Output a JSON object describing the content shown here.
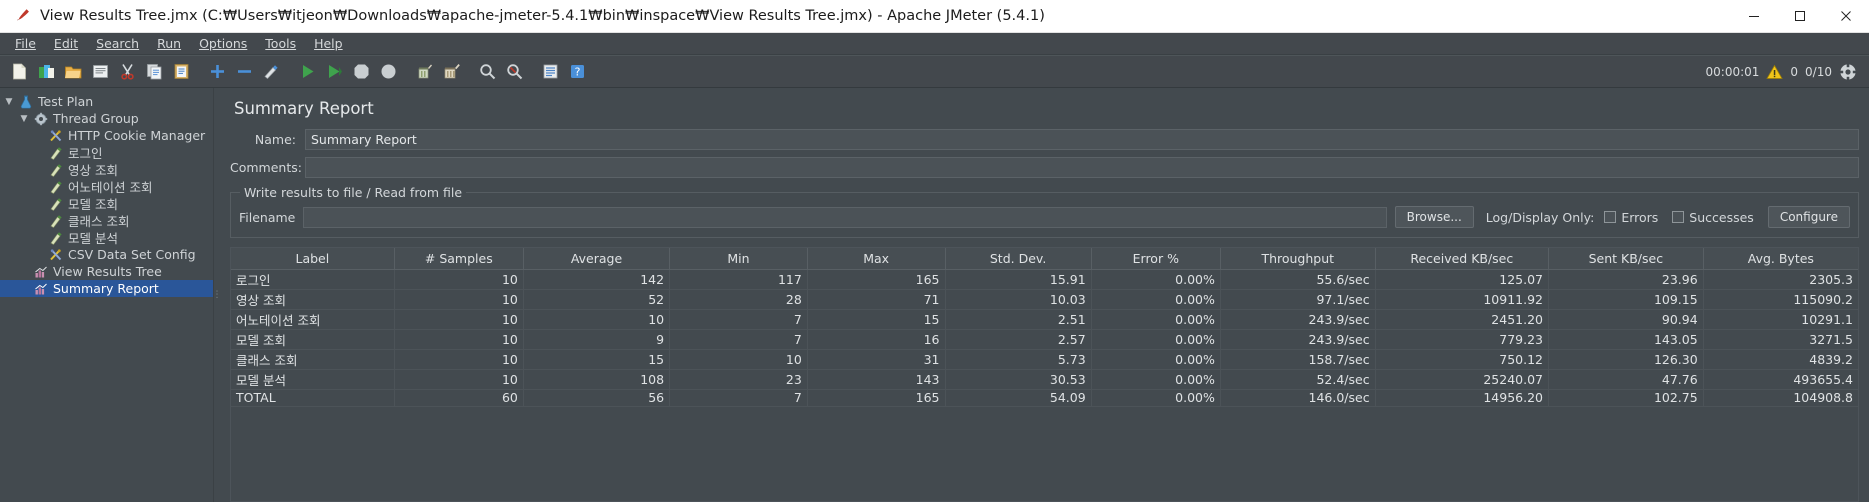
{
  "window": {
    "title": "View Results Tree.jmx (C:₩Users₩itjeon₩Downloads₩apache-jmeter-5.4.1₩bin₩inspace₩View Results Tree.jmx) - Apache JMeter (5.4.1)",
    "app_icon": "jmeter-feather-icon",
    "minimize": "—",
    "maximize": "▢",
    "close": "✕"
  },
  "menubar": {
    "items": [
      {
        "label": "File"
      },
      {
        "label": "Edit"
      },
      {
        "label": "Search"
      },
      {
        "label": "Run"
      },
      {
        "label": "Options"
      },
      {
        "label": "Tools"
      },
      {
        "label": "Help"
      }
    ]
  },
  "toolbar": {
    "buttons": [
      {
        "name": "new-test-plan-icon",
        "tip": "New"
      },
      {
        "name": "templates-icon",
        "tip": "Templates"
      },
      {
        "name": "open-icon",
        "tip": "Open"
      },
      {
        "name": "save-icon",
        "tip": "Save Test Plan"
      },
      {
        "name": "cut-icon",
        "tip": "Cut"
      },
      {
        "name": "copy-icon",
        "tip": "Copy"
      },
      {
        "name": "paste-icon",
        "tip": "Paste"
      },
      {
        "name": "expand-all-icon",
        "tip": "Expand All"
      },
      {
        "name": "collapse-all-icon",
        "tip": "Collapse All"
      },
      {
        "name": "toggle-icon",
        "tip": "Toggle"
      },
      {
        "name": "start-icon",
        "tip": "Start"
      },
      {
        "name": "start-no-timers-icon",
        "tip": "Start no pauses"
      },
      {
        "name": "stop-icon",
        "tip": "Stop"
      },
      {
        "name": "shutdown-icon",
        "tip": "Shutdown"
      },
      {
        "name": "clear-icon",
        "tip": "Clear"
      },
      {
        "name": "clear-all-icon",
        "tip": "Clear All"
      },
      {
        "name": "search-icon",
        "tip": "Search"
      },
      {
        "name": "search-reset-icon",
        "tip": "Reset Search"
      },
      {
        "name": "function-helper-icon",
        "tip": "Function Helper Dialog"
      },
      {
        "name": "help-icon",
        "tip": "Help"
      }
    ],
    "status": {
      "elapsed_time": "00:00:01",
      "warning_icon": "warning-triangle-icon",
      "error_count": "0",
      "thread_counts": "0/10",
      "remote_icon": "remote-engines-icon"
    }
  },
  "tree": {
    "nodes": [
      {
        "label": "Test Plan",
        "indent": 0,
        "icon": "test-plan-icon",
        "expander": "expanded",
        "selected": false
      },
      {
        "label": "Thread Group",
        "indent": 1,
        "icon": "thread-group-icon",
        "expander": "expanded",
        "selected": false
      },
      {
        "label": "HTTP Cookie Manager",
        "indent": 2,
        "icon": "config-element-icon",
        "expander": "none",
        "selected": false
      },
      {
        "label": "로그인",
        "indent": 2,
        "icon": "http-sampler-icon",
        "expander": "none",
        "selected": false
      },
      {
        "label": "영상 조회",
        "indent": 2,
        "icon": "http-sampler-icon",
        "expander": "none",
        "selected": false
      },
      {
        "label": "어노테이션 조회",
        "indent": 2,
        "icon": "http-sampler-icon",
        "expander": "none",
        "selected": false
      },
      {
        "label": "모델 조회",
        "indent": 2,
        "icon": "http-sampler-icon",
        "expander": "none",
        "selected": false
      },
      {
        "label": "클래스 조회",
        "indent": 2,
        "icon": "http-sampler-icon",
        "expander": "none",
        "selected": false
      },
      {
        "label": "모델 분석",
        "indent": 2,
        "icon": "http-sampler-icon",
        "expander": "none",
        "selected": false
      },
      {
        "label": "CSV Data Set Config",
        "indent": 2,
        "icon": "config-element-icon",
        "expander": "none",
        "selected": false
      },
      {
        "label": "View Results Tree",
        "indent": 1,
        "icon": "listener-icon",
        "expander": "none",
        "selected": false
      },
      {
        "label": "Summary Report",
        "indent": 1,
        "icon": "listener-icon",
        "expander": "none",
        "selected": true
      }
    ]
  },
  "panel": {
    "title": "Summary Report",
    "name_label": "Name:",
    "name_value": "Summary Report",
    "comments_label": "Comments:",
    "comments_value": "",
    "group_legend": "Write results to file / Read from file",
    "filename_label": "Filename",
    "filename_value": "",
    "browse_button": "Browse...",
    "log_display_label": "Log/Display Only:",
    "errors_label": "Errors",
    "errors_checked": false,
    "successes_label": "Successes",
    "successes_checked": false,
    "configure_button": "Configure"
  },
  "table": {
    "columns": [
      "Label",
      "# Samples",
      "Average",
      "Min",
      "Max",
      "Std. Dev.",
      "Error %",
      "Throughput",
      "Received KB/sec",
      "Sent KB/sec",
      "Avg. Bytes"
    ],
    "rows": [
      {
        "label": "로그인",
        "samples": "10",
        "average": "142",
        "min": "117",
        "max": "165",
        "stddev": "15.91",
        "error": "0.00%",
        "throughput": "55.6/sec",
        "received": "125.07",
        "sent": "23.96",
        "avgbytes": "2305.3"
      },
      {
        "label": "영상 조회",
        "samples": "10",
        "average": "52",
        "min": "28",
        "max": "71",
        "stddev": "10.03",
        "error": "0.00%",
        "throughput": "97.1/sec",
        "received": "10911.92",
        "sent": "109.15",
        "avgbytes": "115090.2"
      },
      {
        "label": "어노테이션 조회",
        "samples": "10",
        "average": "10",
        "min": "7",
        "max": "15",
        "stddev": "2.51",
        "error": "0.00%",
        "throughput": "243.9/sec",
        "received": "2451.20",
        "sent": "90.94",
        "avgbytes": "10291.1"
      },
      {
        "label": "모델 조회",
        "samples": "10",
        "average": "9",
        "min": "7",
        "max": "16",
        "stddev": "2.57",
        "error": "0.00%",
        "throughput": "243.9/sec",
        "received": "779.23",
        "sent": "143.05",
        "avgbytes": "3271.5"
      },
      {
        "label": "클래스 조회",
        "samples": "10",
        "average": "15",
        "min": "10",
        "max": "31",
        "stddev": "5.73",
        "error": "0.00%",
        "throughput": "158.7/sec",
        "received": "750.12",
        "sent": "126.30",
        "avgbytes": "4839.2"
      },
      {
        "label": "모델 분석",
        "samples": "10",
        "average": "108",
        "min": "23",
        "max": "143",
        "stddev": "30.53",
        "error": "0.00%",
        "throughput": "52.4/sec",
        "received": "25240.07",
        "sent": "47.76",
        "avgbytes": "493655.4"
      },
      {
        "label": "TOTAL",
        "samples": "60",
        "average": "56",
        "min": "7",
        "max": "165",
        "stddev": "54.09",
        "error": "0.00%",
        "throughput": "146.0/sec",
        "received": "14956.20",
        "sent": "102.75",
        "avgbytes": "104908.8"
      }
    ]
  },
  "colors": {
    "window_bg": "#434a4f",
    "titlebar_bg": "#ffffff",
    "selection_blue": "#2a5699",
    "text": "#dfe2e4",
    "border": "#585f64"
  }
}
